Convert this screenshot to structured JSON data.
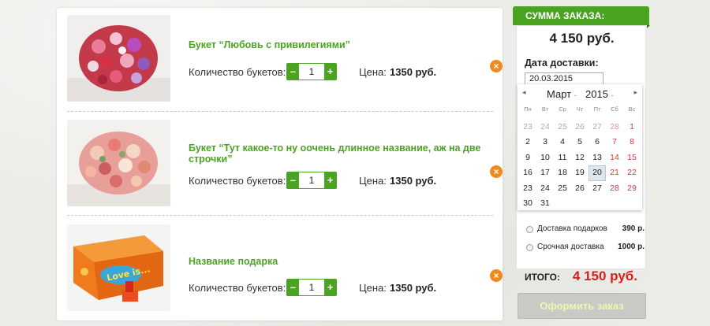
{
  "cart": {
    "items": [
      {
        "title": "Букет “Любовь с привилегиями”",
        "qty_label": "Количество букетов:",
        "qty": "1",
        "minus": "–",
        "plus": "+",
        "price_label": "Цена:",
        "price": "1350 руб.",
        "remove": "×",
        "image_icon": "flower-bouquet-photo"
      },
      {
        "title": "Букет “Тут какое-то ну оочень длинное название, аж на две строчки”",
        "qty_label": "Количество букетов:",
        "qty": "1",
        "minus": "–",
        "plus": "+",
        "price_label": "Цена:",
        "price": "1350 руб.",
        "remove": "×",
        "image_icon": "rose-bouquet-photo"
      },
      {
        "title": "Название подарка",
        "qty_label": "Количество букетов:",
        "qty": "1",
        "minus": "–",
        "plus": "+",
        "price_label": "Цена:",
        "price": "1350 руб.",
        "remove": "×",
        "image_icon": "love-is-gift-box-photo"
      }
    ]
  },
  "summary": {
    "header": "СУММА ЗАКАЗА:",
    "total_top": "4 150 руб.",
    "delivery_label": "Дата доставки:",
    "date_value": "20.03.2015",
    "calendar": {
      "prev": "◂",
      "next": "▸",
      "month": "Март",
      "year": "2015",
      "dow": [
        "Пн",
        "Вт",
        "Ср",
        "Чт",
        "Пт",
        "Сб",
        "Вс"
      ],
      "weeks": [
        [
          "23",
          "24",
          "25",
          "26",
          "27",
          "28",
          "1"
        ],
        [
          "2",
          "3",
          "4",
          "5",
          "6",
          "7",
          "8"
        ],
        [
          "9",
          "10",
          "11",
          "12",
          "13",
          "14",
          "15"
        ],
        [
          "16",
          "17",
          "18",
          "19",
          "20",
          "21",
          "22"
        ],
        [
          "23",
          "24",
          "25",
          "26",
          "27",
          "28",
          "29"
        ],
        [
          "30",
          "31",
          "",
          "",
          "",
          "",
          ""
        ]
      ],
      "selected": "20"
    },
    "options": [
      {
        "label": "Доставка подарков",
        "price": "390 р."
      },
      {
        "label": "Срочная доставка",
        "price": "1000 р."
      }
    ],
    "final_label": "ИТОГО:",
    "final_total": "4 150 руб.",
    "order_button": "Оформить заказ"
  },
  "colors": {
    "accent_green": "#4aa421",
    "remove_orange": "#f08a1c",
    "total_red": "#d71e1e"
  }
}
